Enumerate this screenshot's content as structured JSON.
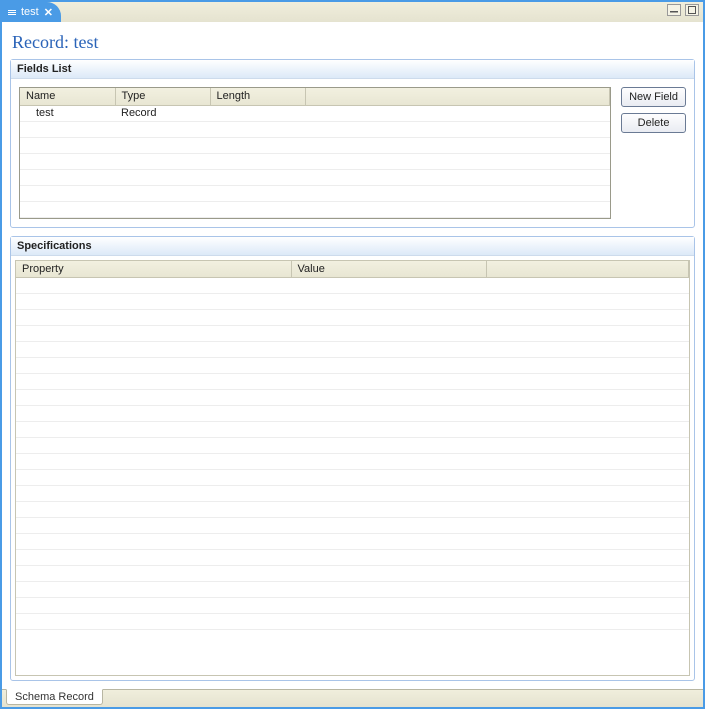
{
  "tab": {
    "label": "test"
  },
  "page": {
    "title": "Record: test"
  },
  "fields_section": {
    "title": "Fields List",
    "columns": [
      "Name",
      "Type",
      "Length",
      ""
    ],
    "rows": [
      {
        "name": "test",
        "type": "Record",
        "length": ""
      }
    ],
    "buttons": {
      "new_field": "New Field",
      "delete": "Delete"
    }
  },
  "specs_section": {
    "title": "Specifications",
    "columns": [
      "Property",
      "Value",
      ""
    ],
    "rows": []
  },
  "footer": {
    "active_tab": "Schema Record"
  }
}
